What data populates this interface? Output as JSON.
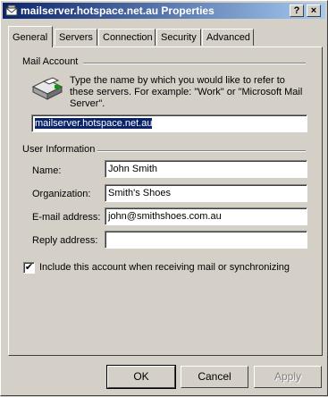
{
  "window": {
    "title": "mailserver.hotspace.net.au Properties",
    "help_btn": "?",
    "close_btn": "×"
  },
  "tabs": [
    {
      "label": "General",
      "active": true
    },
    {
      "label": "Servers"
    },
    {
      "label": "Connection"
    },
    {
      "label": "Security"
    },
    {
      "label": "Advanced"
    }
  ],
  "mail_account": {
    "heading": "Mail Account",
    "description": "Type the name by which you would like to refer to these servers.  For example: \"Work\" or \"Microsoft Mail Server\".",
    "account_name": "mailserver.hotspace.net.au"
  },
  "user_info": {
    "heading": "User Information",
    "name_label": "Name:",
    "name_value": "John Smith",
    "org_label": "Organization:",
    "org_value": "Smith's Shoes",
    "email_label": "E-mail address:",
    "email_value": "john@smithshoes.com.au",
    "reply_label": "Reply address:",
    "reply_value": ""
  },
  "include_checkbox": {
    "label": "Include this account when receiving mail or synchronizing",
    "checked": true,
    "mark": "✔"
  },
  "buttons": {
    "ok": "OK",
    "cancel": "Cancel",
    "apply": "Apply"
  }
}
